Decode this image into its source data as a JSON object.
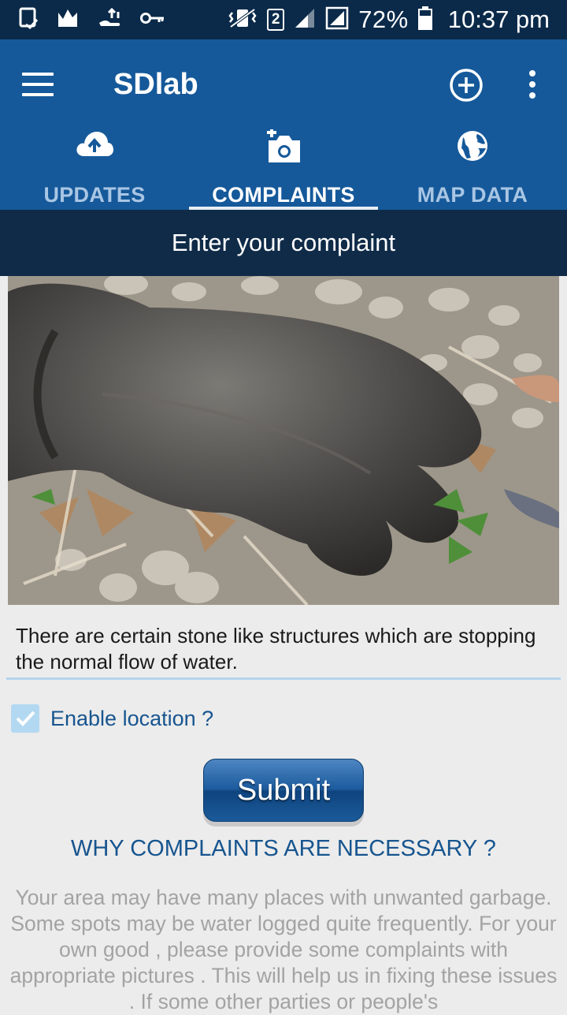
{
  "status_bar": {
    "notif_icons": [
      "tablet-check-icon",
      "stats-icon",
      "hand-upload-icon",
      "key-icon"
    ],
    "sim_slot": "2",
    "battery": "72%",
    "time": "10:37 pm"
  },
  "app_bar": {
    "title": "SDlab",
    "tabs": [
      {
        "label": "UPDATES",
        "icon": "cloud-upload-icon",
        "active": false
      },
      {
        "label": "COMPLAINTS",
        "icon": "add-photo-icon",
        "active": true
      },
      {
        "label": "MAP DATA",
        "icon": "globe-icon",
        "active": false
      }
    ]
  },
  "subheader": "Enter your complaint",
  "complaint": {
    "description": "There are certain stone like structures which are stopping the normal flow of water.",
    "enable_location_label": "Enable location ?",
    "enable_location_checked": true,
    "submit_label": "Submit"
  },
  "why_heading": "WHY COMPLAINTS ARE NECESSARY ?",
  "info_text": "Your area may have many places with unwanted garbage. Some spots may be water logged quite frequently. For your own good , please provide some complaints with appropriate pictures . This will help us in fixing these issues . If some other parties or people's",
  "colors": {
    "status_bar": "#0b2a4a",
    "app_bar": "#15599a",
    "subheader": "#0f2b48",
    "accent_text": "#17558f",
    "muted_text": "#a3a3a3"
  }
}
